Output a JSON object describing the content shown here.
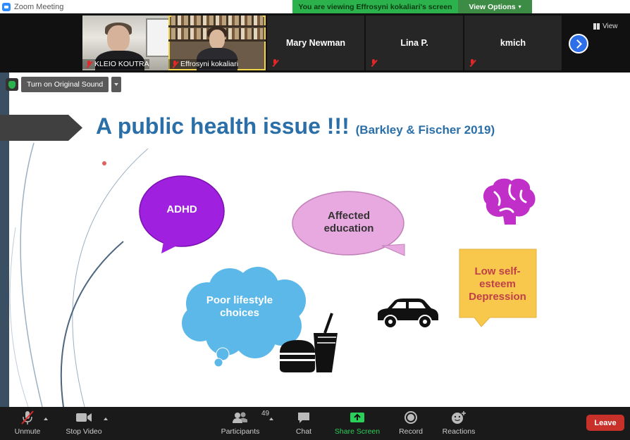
{
  "titlebar": {
    "title": "Zoom Meeting"
  },
  "banner": {
    "message": "You are viewing Effrosyni kokaliari's screen",
    "options_label": "View Options"
  },
  "gallery": {
    "tiles": [
      {
        "name": "KLEIO KOUTRA",
        "video": true
      },
      {
        "name": "Effrosyni kokaliari",
        "video": true
      },
      {
        "name": "Mary Newman",
        "video": false
      },
      {
        "name": "Lina P.",
        "video": false
      },
      {
        "name": "kmich",
        "video": false
      }
    ],
    "view_label": "View"
  },
  "share": {
    "original_sound_label": "Turn on Original Sound"
  },
  "slide": {
    "title": "A public health issue !!!",
    "citation": "(Barkley & Fischer 2019)",
    "bubbles": {
      "adhd": "ADHD",
      "education": "Affected education",
      "lifestyle": "Poor lifestyle choices",
      "esteem": "Low self-esteem Depression"
    },
    "colors": {
      "title": "#2a6fa8",
      "adhd": "#a020e0",
      "education": "#e8a8e0",
      "lifestyle": "#5cb8e8",
      "esteem": "#f8c84c",
      "brain": "#c030c8"
    }
  },
  "toolbar": {
    "unmute": "Unmute",
    "stop_video": "Stop Video",
    "participants": "Participants",
    "participants_count": "49",
    "chat": "Chat",
    "share_screen": "Share Screen",
    "record": "Record",
    "reactions": "Reactions",
    "leave": "Leave"
  }
}
